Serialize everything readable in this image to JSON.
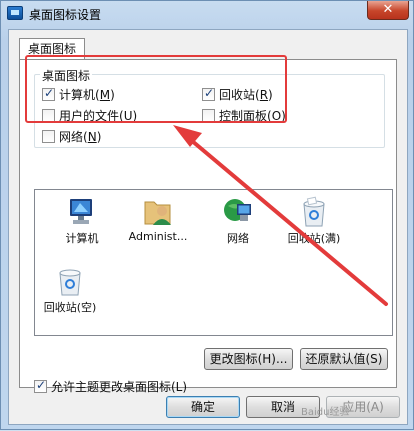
{
  "window": {
    "title": "桌面图标设置",
    "close_glyph": "✕"
  },
  "tab": {
    "label": "桌面图标"
  },
  "group": {
    "label": "桌面图标",
    "checkboxes": [
      {
        "label": "计算机",
        "hotkey": "M",
        "checked": true
      },
      {
        "label": "回收站",
        "hotkey": "R",
        "checked": true
      },
      {
        "label": "用户的文件",
        "hotkey": "U",
        "checked": false
      },
      {
        "label": "控制面板",
        "hotkey": "O",
        "checked": false
      },
      {
        "label": "网络",
        "hotkey": "N",
        "checked": false
      }
    ]
  },
  "icons": [
    {
      "label": "计算机",
      "icon": "computer-icon"
    },
    {
      "label": "Administ...",
      "icon": "user-folder-icon"
    },
    {
      "label": "网络",
      "icon": "network-icon"
    },
    {
      "label": "回收站(满)",
      "icon": "recycle-bin-full-icon"
    },
    {
      "label": "回收站(空)",
      "icon": "recycle-bin-empty-icon"
    }
  ],
  "buttons": {
    "change_icon": "更改图标(H)...",
    "restore_default": "还原默认值(S)",
    "ok": "确定",
    "cancel": "取消",
    "apply": "应用(A)"
  },
  "allow_themes": {
    "label": "允许主题更改桌面图标(L)",
    "checked": true
  },
  "annotation_color": "#e33b3b",
  "watermark": "Baidu经验"
}
